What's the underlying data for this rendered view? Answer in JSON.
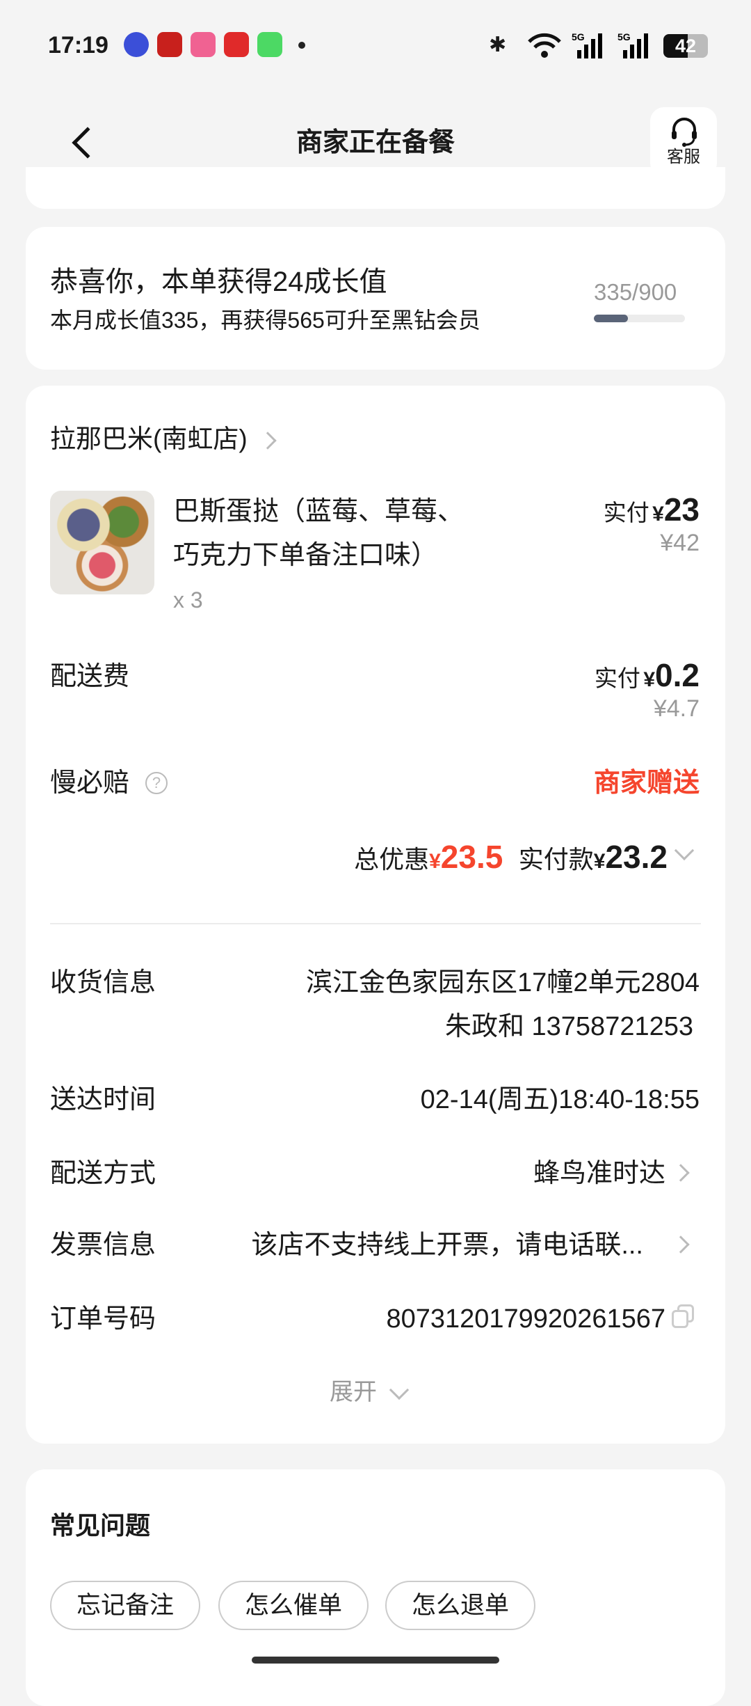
{
  "status_bar": {
    "time": "17:19",
    "battery": "42",
    "network": "5G"
  },
  "header": {
    "title": "商家正在备餐",
    "service_label": "客服"
  },
  "growth": {
    "title": "恭喜你，本单获得24成长值",
    "subtitle": "本月成长值335，再获得565可升至黑钻会员",
    "progress_text": "335/900",
    "progress_value": 335,
    "progress_max": 900
  },
  "order": {
    "store_name": "拉那巴米(南虹店)",
    "item": {
      "name_line1": "巴斯蛋挞（蓝莓、草莓、",
      "name_line2": "巧克力下单备注口味）",
      "qty": "x 3",
      "paid_label": "实付",
      "paid_currency": "¥",
      "paid": "23",
      "original": "¥42"
    },
    "delivery_fee": {
      "label": "配送费",
      "paid_label": "实付",
      "currency": "¥",
      "paid": "0.2",
      "original": "¥4.7"
    },
    "slow_compensation": {
      "label": "慢必赔",
      "value": "商家赠送"
    },
    "summary": {
      "discount_label": "总优惠",
      "discount_currency": "¥",
      "discount": "23.5",
      "paid_label": "实付款",
      "paid_currency": "¥",
      "paid": "23.2"
    },
    "info": {
      "address_label": "收货信息",
      "address": "滨江金色家园东区17幢2单元2804",
      "contact": "朱政和 13758721253",
      "time_label": "送达时间",
      "time": "02-14(周五)18:40-18:55",
      "method_label": "配送方式",
      "method": "蜂鸟准时达",
      "invoice_label": "发票信息",
      "invoice": "该店不支持线上开票，请电话联...",
      "order_no_label": "订单号码",
      "order_no": "8073120179920261567"
    },
    "expand_label": "展开"
  },
  "faq": {
    "title": "常见问题",
    "items": [
      "忘记备注",
      "怎么催单",
      "怎么退单"
    ]
  },
  "colors": {
    "accent": "#f5452d",
    "background": "#f4f4f4",
    "progress": "#5a6478"
  }
}
